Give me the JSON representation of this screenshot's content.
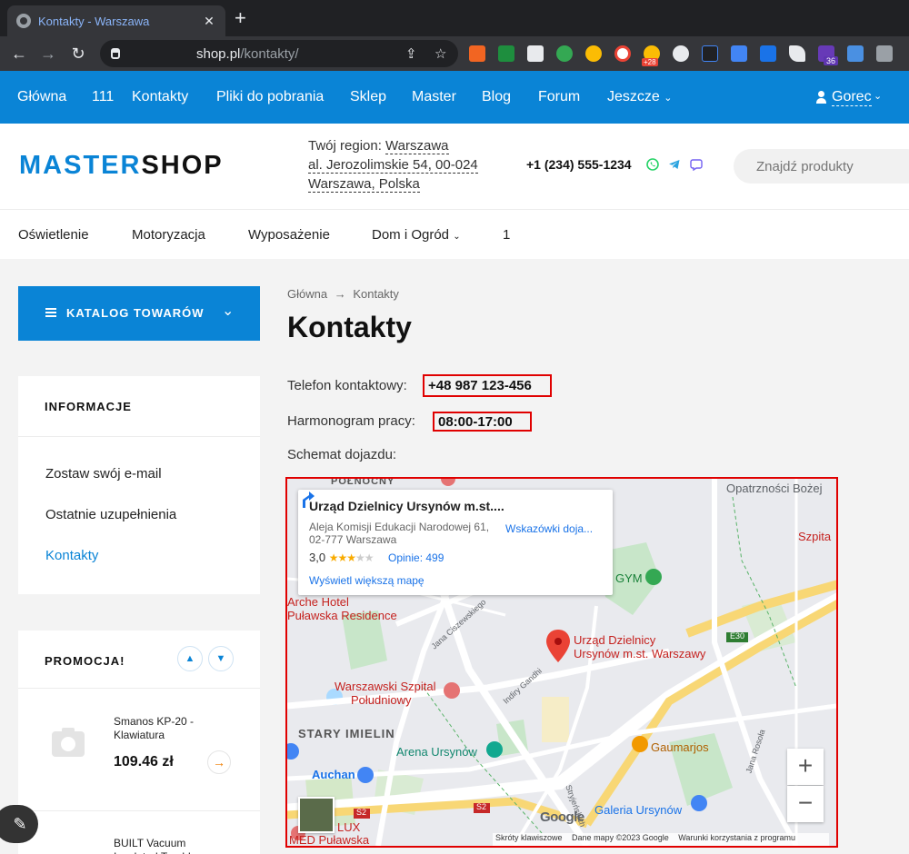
{
  "browser": {
    "tab_title": "Kontakty - Warszawa",
    "tab_close": "✕",
    "new_tab": "+",
    "url_domain": "shop.pl",
    "url_path": "/kontakty/",
    "ext_badge_weather": "+28",
    "ext_badge_count": "36"
  },
  "topnav": {
    "items": [
      "Główna",
      "111",
      "Kontakty",
      "Pliki do pobrania",
      "Sklep",
      "Master",
      "Blog",
      "Forum",
      "Jeszcze"
    ],
    "user": "Gorec"
  },
  "header": {
    "logo_accent": "MASTER",
    "logo_rest": "SHOP",
    "region_prefix": "Twój region:",
    "region_city": "Warszawa",
    "address_line1": "al. Jerozolimskie 54, 00-024",
    "address_line2": "Warszawa, Polska",
    "phone": "+1 (234) 555-1234",
    "search_placeholder": "Znajdź produkty"
  },
  "categories": [
    "Oświetlenie",
    "Motoryzacja",
    "Wyposażenie",
    "Dom i Ogród",
    "1"
  ],
  "sidebar": {
    "catalog_label": "KATALOG TOWARÓW",
    "info_title": "INFORMACJE",
    "info_links": [
      "Zostaw swój e-mail",
      "Ostatnie uzupełnienia",
      "Kontakty"
    ],
    "promo_title": "PROMOCJA!",
    "products": [
      {
        "name": "Smanos KP-20 - Klawiatura",
        "price": "109.46 zł"
      },
      {
        "name": "BUILT Vacuum Insulated Tumbler",
        "price": ""
      }
    ]
  },
  "main": {
    "breadcrumb_home": "Główna",
    "breadcrumb_arrow": "→",
    "breadcrumb_current": "Kontakty",
    "title": "Kontakty",
    "phone_label": "Telefon kontaktowy:",
    "phone_value": "+48 987 123-456",
    "hours_label": "Harmonogram pracy:",
    "hours_value": "08:00-17:00",
    "directions_label": "Schemat dojazdu:"
  },
  "map": {
    "card_title": "Urząd Dzielnicy Ursynów m.st....",
    "card_address": "Aleja Komisji Edukacji Narodowej 61, 02-777 Warszawa",
    "rating": "3,0",
    "rating_stars": 3,
    "reviews": "Opinie: 499",
    "bigger_map": "Wyświetl większą mapę",
    "directions": "Wskazówki doja...",
    "pin_label_1": "Urząd Dzielnicy",
    "pin_label_2": "Ursynów m.st. Warszawy",
    "labels": {
      "north": "PÓŁNOCNY",
      "opatrznosci": "Opatrzności Bożej",
      "szpital_short": "Szpita",
      "gym": "GYM",
      "arche1": "Arche Hotel",
      "arche2": "Puławska Residence",
      "hospital1": "Warszawski Szpital",
      "hospital2": "Południowy",
      "imielin": "STARY IMIELIN",
      "arena": "Arena Ursynów",
      "auchan": "Auchan",
      "gaumarjos": "Gaumarjos",
      "galeria": "Galeria Ursynów",
      "lux": "LUX",
      "med": "MED Puławska",
      "e30": "E30",
      "s2a": "S2",
      "s2b": "S2",
      "street_ciszewskiego": "Jana Ciszewskiego",
      "street_gandhi": "Indiry Gandhi",
      "street_rosola": "Jana Rosoła",
      "street_stryjenskich": "Stryjeńskich"
    },
    "zoom_in": "+",
    "zoom_out": "−",
    "google": "Google",
    "attribution": {
      "shortcuts": "Skróty klawiszowe",
      "data": "Dane mapy ©2023 Google",
      "terms": "Warunki korzystania z programu"
    }
  },
  "colors": {
    "accent": "#0a84d6",
    "highlight_border": "#e00000",
    "price_arrow": "#ef7d00"
  }
}
